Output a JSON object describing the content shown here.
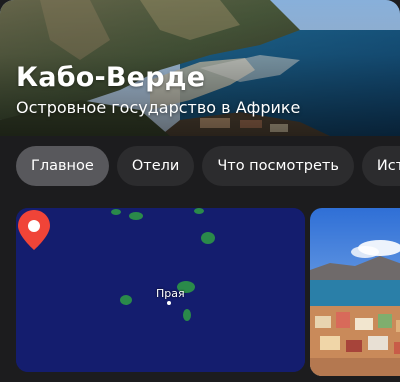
{
  "header": {
    "title": "Кабо-Верде",
    "subtitle": "Островное государство в Африке"
  },
  "tabs": [
    {
      "label": "Главное",
      "active": true
    },
    {
      "label": "Отели",
      "active": false
    },
    {
      "label": "Что посмотреть",
      "active": false
    },
    {
      "label": "Истори",
      "active": false
    }
  ],
  "map": {
    "city_label": "Прая",
    "pin_icon": "location-pin-icon",
    "pin_color": "#f04438",
    "background_color": "#141d6e"
  },
  "colors": {
    "background": "#1c1c1e",
    "tab_bg": "#2c2c2e",
    "tab_active_bg": "#58585c"
  }
}
